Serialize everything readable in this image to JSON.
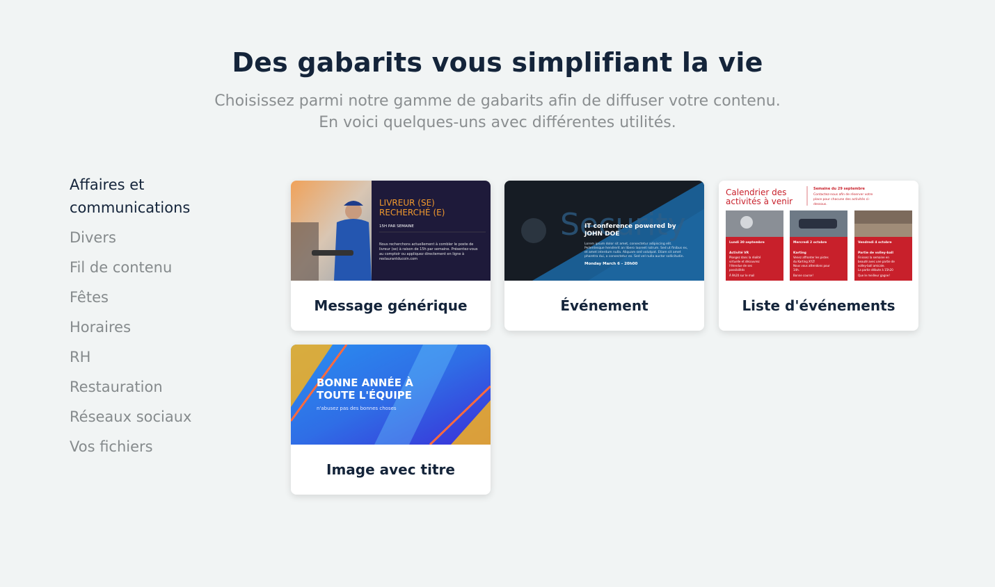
{
  "header": {
    "title": "Des gabarits vous simplifiant la vie",
    "subtitle_line1": "Choisissez parmi notre gamme de gabarits afin de diffuser votre contenu.",
    "subtitle_line2": "En voici quelques-uns avec différentes utilités."
  },
  "categories": [
    {
      "label": "Affaires et communications",
      "active": true
    },
    {
      "label": "Divers"
    },
    {
      "label": "Fil de contenu"
    },
    {
      "label": "Fêtes"
    },
    {
      "label": "Horaires"
    },
    {
      "label": "RH"
    },
    {
      "label": "Restauration"
    },
    {
      "label": "Réseaux sociaux"
    },
    {
      "label": "Vos fichiers"
    }
  ],
  "templates": [
    {
      "label": "Message générique",
      "thumb": {
        "headline1": "LIVREUR (SE)",
        "headline2": "RECHERCHÉ (E)",
        "tag": "15H PAR SEMAINE",
        "body1": "Nous recherchons actuellement à combler le poste de",
        "body2": "livreur (se) à raison de 15h par semaine. Présentez-vous",
        "body3": "au comptoir ou appliquez directement en ligne à",
        "body4": "restaurantducoin.com"
      }
    },
    {
      "label": "Événement",
      "thumb": {
        "bg_word": "Security",
        "headline1": "IT conference powered by",
        "headline2": "JOHN DOE",
        "body1": "Lorem ipsum dolor sit amet, consectetur adipiscing elit.",
        "body2": "Pellentesque hendrerit an libero laoreet rutrum. Sed ut finibus ex,",
        "body3": "et amet interdum nulla. Aliquam sed volutpat. Etiam sit amet",
        "body4": "pharetra dui, a consectetur ex. Sed vel nulla auctor sollicitudin.",
        "date": "Monday March 6 - 20h00"
      }
    },
    {
      "label": "Liste d'événements",
      "thumb": {
        "title1": "Calendrier des",
        "title2": "activités à venir",
        "week1": "Semaine du 29 septembre",
        "week2": "Contactez-nous afin de réserver votre",
        "week3": "place pour chacune des activités ci-",
        "week4": "dessous.",
        "col1_date": "Lundi 30 septembre",
        "col1_title": "Activité VR",
        "col1_l1": "Plongez dans la réalité",
        "col1_l2": "virtuelle et découvrez",
        "col1_l3": "l'étendue de ses",
        "col1_l4": "possibilités",
        "col1_l5": "À 9h20 sur le mail",
        "col2_date": "Mercredi 2 octobre",
        "col2_title": "Karting",
        "col2_l1": "Venez affronter les pistes",
        "col2_l2": "du Karting XYZ!",
        "col2_l3": "Nous vous attendons pour",
        "col2_l4": "14h.",
        "col2_l5": "Bonne course!",
        "col3_date": "Vendredi 4 octobre",
        "col3_title": "Partie de volley-ball",
        "col3_l1": "Finissez la semaine en",
        "col3_l2": "beauté avec une partie de",
        "col3_l3": "volley-ball amicale.",
        "col3_l4": "La partie débute à 15h20",
        "col3_l5": "Que le meilleur gagne!"
      }
    },
    {
      "label": "Image avec titre",
      "thumb": {
        "headline1": "BONNE ANNÉE À",
        "headline2": "TOUTE L'ÉQUIPE",
        "sub": "n'abusez pas des bonnes choses"
      }
    }
  ],
  "colors": {
    "background": "#f1f4f4",
    "title": "#14243a",
    "muted": "#858a8c",
    "accent_orange": "#f29a2e",
    "accent_red": "#c8202b",
    "accent_blue": "#1a5d92"
  }
}
